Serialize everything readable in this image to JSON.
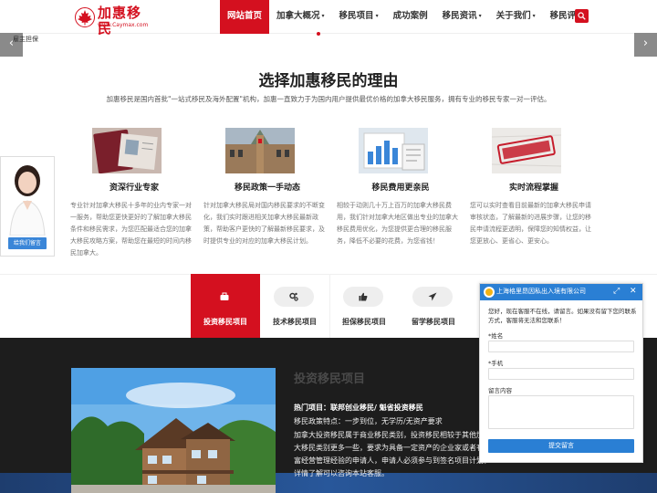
{
  "nav": {
    "logo_text": "加惠移民",
    "logo_url": "www.Caymax.com",
    "items": [
      {
        "label": "网站首页",
        "active": true,
        "dropdown": false
      },
      {
        "label": "加拿大概况",
        "active": false,
        "dropdown": true
      },
      {
        "label": "移民项目",
        "active": false,
        "dropdown": true
      },
      {
        "label": "成功案例",
        "active": false,
        "dropdown": false
      },
      {
        "label": "移民资讯",
        "active": false,
        "dropdown": true
      },
      {
        "label": "关于我们",
        "active": false,
        "dropdown": true
      },
      {
        "label": "移民评估",
        "active": false,
        "dropdown": false
      }
    ],
    "caret": "▾",
    "search_icon": "search-icon"
  },
  "slider": {
    "prev": "‹",
    "next": "›",
    "crumb": "雇主担保"
  },
  "colors": {
    "brand": "#d4101f",
    "chat_blue": "#2a7fd4",
    "dark_bg": "#1d1d1d"
  },
  "why": {
    "title": "选择加惠移民的理由",
    "intro": "加惠移民是国内首批\"一站式移民及海外配置\"机构，加惠一直致力于为国内用户提供最优价格的加拿大移民服务，拥有专业的移民专家一对一评估。",
    "features": [
      {
        "title": "资深行业专家",
        "desc": "专业针对加拿大移民十多年的业内专家一对一服务，帮助您更快更好的了解加拿大移民条件和移民需求，为您匹配最适合您的加拿大移民攻略方案，帮助您在最短的时间内移民加拿大。"
      },
      {
        "title": "移民政策一手动态",
        "desc": "针对加拿大移民局对国内移民要求的不断变化，我们实时跟进相关加拿大移民最新政策，帮助客户更快的了解最新移民要求，及时提供专业的对应的加拿大移民计划。"
      },
      {
        "title": "移民费用更亲民",
        "desc": "相较于动则几十万上百万的加拿大移民费用，我们针对加拿大地区做出专业的加拿大移民费用优化，为您提供更合理的移民服务，降低不必要的花费，为您省钱！"
      },
      {
        "title": "实时流程掌握",
        "desc": "您可以实时查看目前最新的加拿大移民申请审核状态，了解最新的进展步骤，让您的移民申请流程更透明，保障您的知情权益，让您更放心、更省心、更安心。"
      }
    ]
  },
  "agent": {
    "button": "给我们留言"
  },
  "tabs": [
    {
      "label": "投资移民项目",
      "icon": "briefcase-icon",
      "active": true
    },
    {
      "label": "技术移民项目",
      "icon": "gears-icon",
      "active": false
    },
    {
      "label": "担保移民项目",
      "icon": "thumbs-up-icon",
      "active": false
    },
    {
      "label": "留学移民项目",
      "icon": "plane-icon",
      "active": false
    }
  ],
  "invest": {
    "title": "投资移民项目",
    "hot": "热门项目：联邦创业移民/ 魁省投资移民",
    "policy": "移民政策特点：一步到位，无学历/无资产要求",
    "desc": "加拿大投资移民属于商业移民类别，投资移民相较于其他加拿大移民类别更多一些，要求为具备一定资产的企业家或者有丰富经营管理经验的申请人，申请人必须参与到签名项目计划，详情了解可以咨询本站客服。"
  },
  "chat": {
    "company": "上海格里昂因私出入境有限公司",
    "message": "您好，现在客服不在线，请留言。如果没有留下您的联系方式，客服将无法和您联系！",
    "name_label": "*姓名",
    "phone_label": "*手机",
    "content_label": "留言内容",
    "submit": "提交留言",
    "minimize": "⤢",
    "close": "✕"
  }
}
